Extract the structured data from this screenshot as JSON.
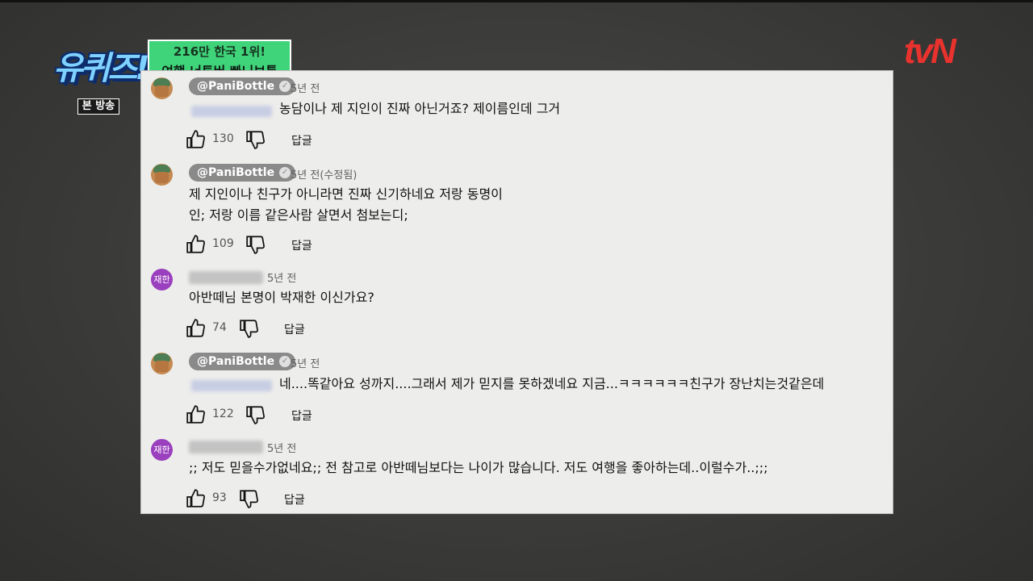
{
  "overlay": {
    "show_logo": "유퀴즈!",
    "broadcast_badge": "본 방송",
    "caption_line1": "216만 한국 1위!",
    "caption_line2": "여행 너튜버 빠니보틀",
    "channel_logo": "tvN"
  },
  "comments": [
    {
      "author": "@PaniBottle",
      "verified": true,
      "time": "5년 전",
      "text": "농담이나 제 지인이 진짜 아닌거죠? 제이름인데 그거",
      "likes": "130",
      "reply_label": "답글"
    },
    {
      "author": "@PaniBottle",
      "verified": true,
      "time": "5년 전(수정됨)",
      "text_lines": [
        "제 지인이나 친구가 아니라면 진짜 신기하네요 저랑 동명이",
        "인; 저랑 이름 같은사람 살면서 첨보는디;"
      ],
      "likes": "109",
      "reply_label": "답글"
    },
    {
      "avatar_text": "재한",
      "time": "5년 전",
      "text": "아반떼님 본명이 박재한 이신가요?",
      "likes": "74",
      "reply_label": "답글"
    },
    {
      "author": "@PaniBottle",
      "verified": true,
      "time": "5년 전",
      "text": "네....똑같아요 성까지....그래서 제가 믿지를 못하겠네요 지금...ㅋㅋㅋㅋㅋㅋ친구가 장난치는것같은데",
      "likes": "122",
      "reply_label": "답글"
    },
    {
      "avatar_text": "재한",
      "time": "5년 전",
      "text": ";; 저도 믿을수가없네요;; 전 참고로 아반떼님보다는 나이가 많습니다. 저도 여행을 좋아하는데..이럴수가..;;;",
      "likes": "93",
      "reply_label": "답글"
    }
  ]
}
